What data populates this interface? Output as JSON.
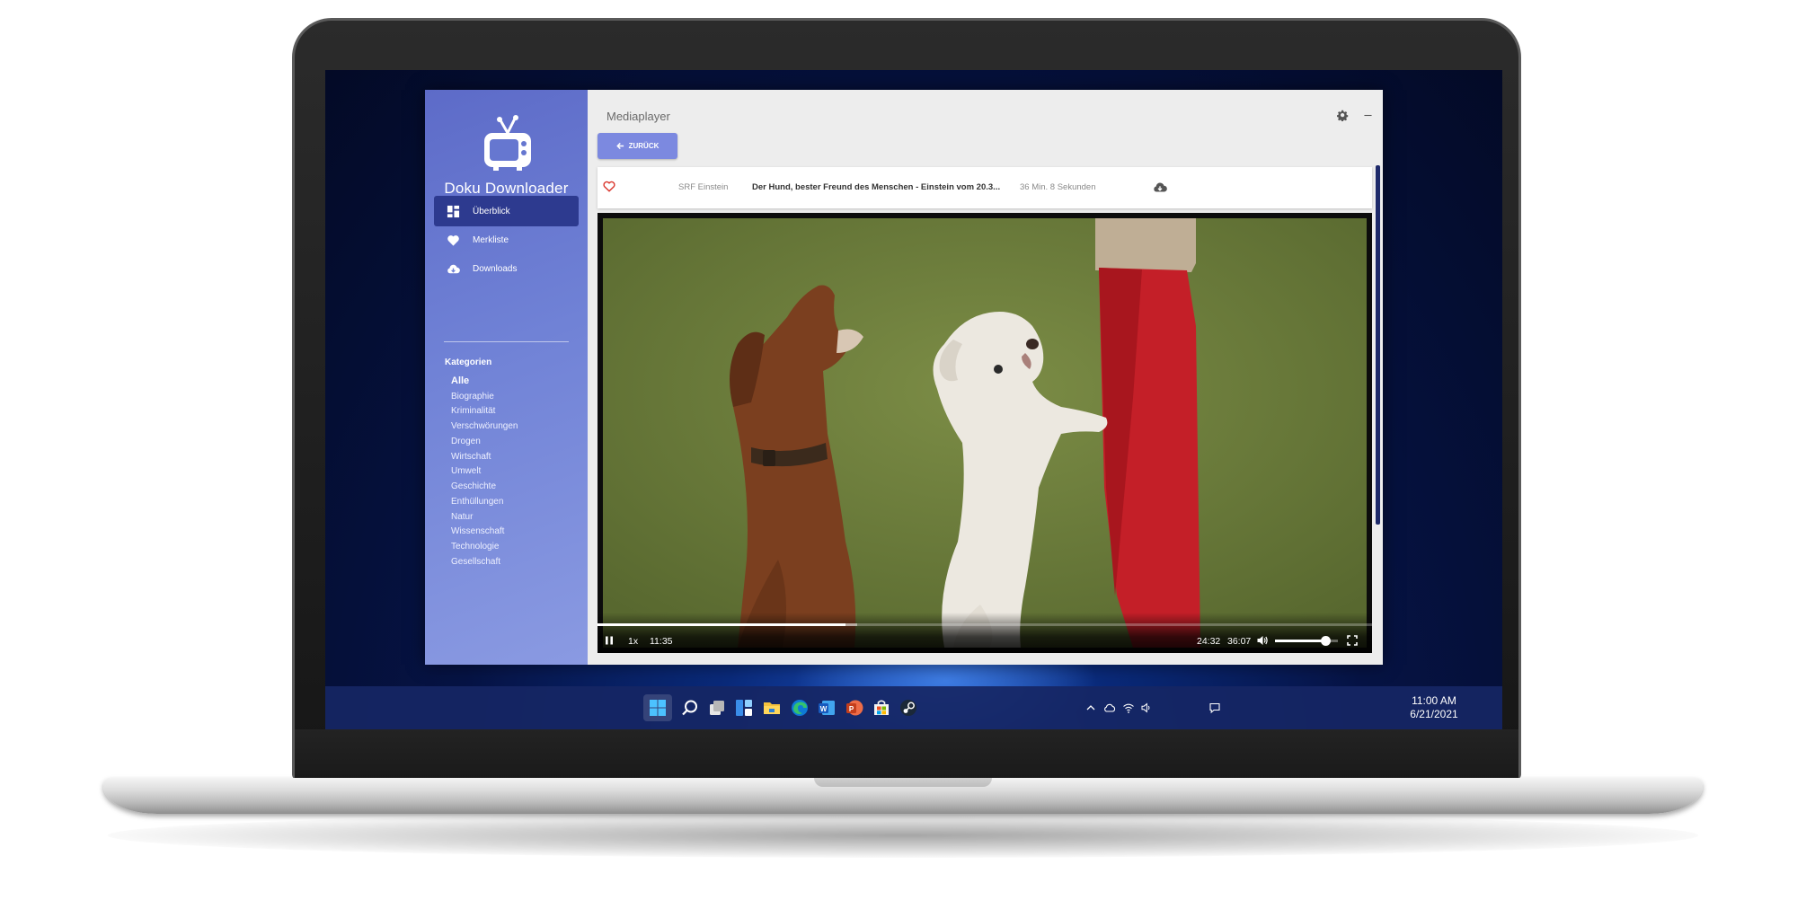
{
  "app": {
    "title": "Doku Downloader",
    "nav": [
      {
        "label": "Überblick",
        "icon": "dashboard-icon",
        "active": true
      },
      {
        "label": "Merkliste",
        "icon": "heart-icon",
        "active": false
      },
      {
        "label": "Downloads",
        "icon": "cloud-download-icon",
        "active": false
      }
    ],
    "categories_heading": "Kategorien",
    "categories": [
      "Alle",
      "Biographie",
      "Kriminalität",
      "Verschwörungen",
      "Drogen",
      "Wirtschaft",
      "Umwelt",
      "Geschichte",
      "Enthüllungen",
      "Natur",
      "Wissenschaft",
      "Technologie",
      "Gesellschaft"
    ],
    "active_category": "Alle",
    "accent_color": "#7c89e0",
    "sidebar_active_color": "#2d3a8f"
  },
  "window": {
    "title": "Mediaplayer",
    "controls": [
      "settings-icon",
      "minimize-icon",
      "maximize-icon",
      "close-icon"
    ]
  },
  "back_button": {
    "label": "ZURÜCK",
    "icon": "arrow-left-icon"
  },
  "media": {
    "favorite_icon": "heart-outline-icon",
    "channel": "SRF Einstein",
    "title": "Der Hund, bester Freund des Menschen - Einstein vom 20.3...",
    "duration": "36 Min. 8 Sekunden",
    "download_icon": "cloud-download-icon"
  },
  "player": {
    "playback_rate": "1x",
    "elapsed": "11:35",
    "remaining": "24:32",
    "total": "36:07",
    "progress": 0.32,
    "buffered": 0.335,
    "volume": 0.8,
    "icons": [
      "pause-icon",
      "volume-icon",
      "fullscreen-icon"
    ]
  },
  "taskbar": {
    "icons": [
      "start-icon",
      "search-icon",
      "task-view-icon",
      "widgets-icon",
      "file-explorer-icon",
      "edge-icon",
      "word-icon",
      "powerpoint-icon",
      "store-icon",
      "steam-icon"
    ],
    "tray": [
      "chevron-up-icon",
      "onedrive-icon",
      "wifi-icon",
      "volume-icon"
    ],
    "time": "11:00 AM",
    "date": "6/21/2021",
    "notification_icon": "notification-icon"
  }
}
